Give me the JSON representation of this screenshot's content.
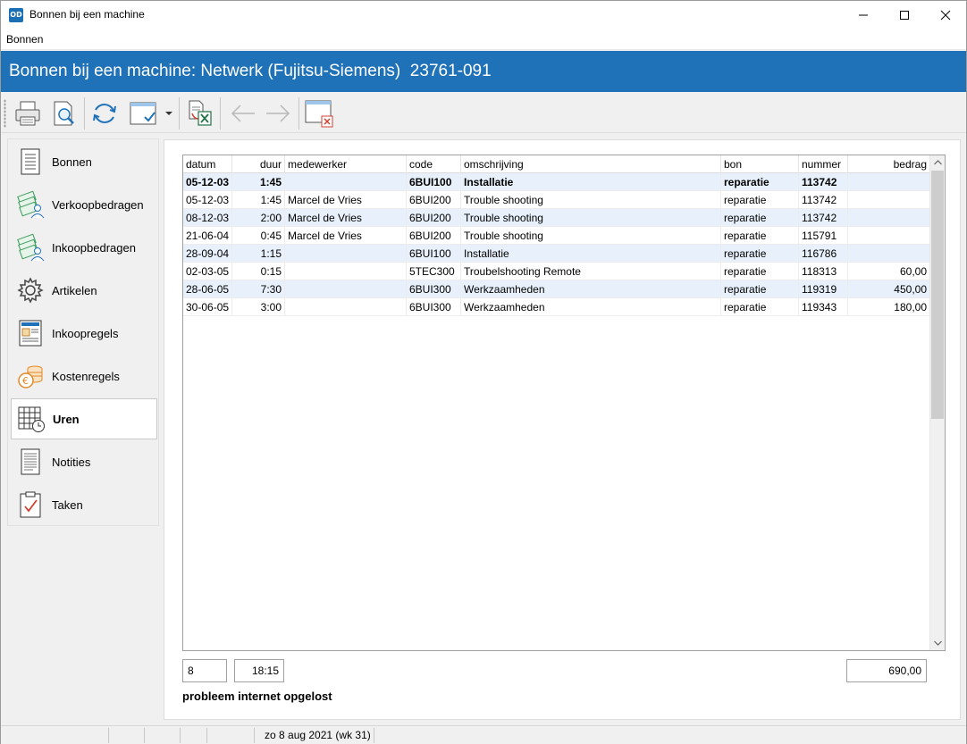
{
  "window": {
    "app_icon_text": "OD",
    "title": "Bonnen bij een machine"
  },
  "menu": {
    "items": [
      "Bonnen"
    ]
  },
  "header": {
    "title": "Bonnen bij een machine: Netwerk (Fujitsu-Siemens)  23761-091",
    "color": "#1f72b8"
  },
  "toolbar": {
    "buttons": [
      {
        "icon": "printer-icon"
      },
      {
        "icon": "print-preview-icon"
      },
      {
        "icon": "refresh-icon"
      },
      {
        "icon": "select-columns-icon"
      },
      {
        "icon": "export-excel-icon"
      },
      {
        "icon": "arrow-left-icon",
        "enabled": false
      },
      {
        "icon": "arrow-right-icon",
        "enabled": false
      },
      {
        "icon": "close-window-icon"
      }
    ]
  },
  "sidebar": {
    "items": [
      {
        "label": "Bonnen",
        "icon": "document-icon"
      },
      {
        "label": "Verkoopbedragen",
        "icon": "money-person-icon"
      },
      {
        "label": "Inkoopbedragen",
        "icon": "money-person-icon"
      },
      {
        "label": "Artikelen",
        "icon": "gear-icon"
      },
      {
        "label": "Inkoopregels",
        "icon": "invoice-icon"
      },
      {
        "label": "Kostenregels",
        "icon": "coins-euro-icon"
      },
      {
        "label": "Uren",
        "icon": "calendar-clock-icon",
        "active": true
      },
      {
        "label": "Notities",
        "icon": "notes-icon"
      },
      {
        "label": "Taken",
        "icon": "clipboard-check-icon"
      }
    ]
  },
  "table": {
    "columns": [
      "datum",
      "duur",
      "medewerker",
      "code",
      "omschrijving",
      "bon",
      "nummer",
      "bedrag"
    ],
    "rows": [
      {
        "datum": "05-12-03",
        "duur": "1:45",
        "medewerker": "",
        "code": "6BUI100",
        "omschrijving": "Installatie",
        "bon": "reparatie",
        "nummer": "113742",
        "bedrag": "",
        "bold": true
      },
      {
        "datum": "05-12-03",
        "duur": "1:45",
        "medewerker": "Marcel de Vries",
        "code": "6BUI200",
        "omschrijving": "Trouble shooting",
        "bon": "reparatie",
        "nummer": "113742",
        "bedrag": ""
      },
      {
        "datum": "08-12-03",
        "duur": "2:00",
        "medewerker": "Marcel de Vries",
        "code": "6BUI200",
        "omschrijving": "Trouble shooting",
        "bon": "reparatie",
        "nummer": "113742",
        "bedrag": ""
      },
      {
        "datum": "21-06-04",
        "duur": "0:45",
        "medewerker": "Marcel de Vries",
        "code": "6BUI200",
        "omschrijving": "Trouble shooting",
        "bon": "reparatie",
        "nummer": "115791",
        "bedrag": ""
      },
      {
        "datum": "28-09-04",
        "duur": "1:15",
        "medewerker": "",
        "code": "6BUI100",
        "omschrijving": "Installatie",
        "bon": "reparatie",
        "nummer": "116786",
        "bedrag": ""
      },
      {
        "datum": "02-03-05",
        "duur": "0:15",
        "medewerker": "",
        "code": "5TEC300",
        "omschrijving": "Troubelshooting Remote",
        "bon": "reparatie",
        "nummer": "118313",
        "bedrag": "60,00"
      },
      {
        "datum": "28-06-05",
        "duur": "7:30",
        "medewerker": "",
        "code": "6BUI300",
        "omschrijving": "Werkzaamheden",
        "bon": "reparatie",
        "nummer": "119319",
        "bedrag": "450,00"
      },
      {
        "datum": "30-06-05",
        "duur": "3:00",
        "medewerker": "",
        "code": "6BUI300",
        "omschrijving": "Werkzaamheden",
        "bon": "reparatie",
        "nummer": "119343",
        "bedrag": "180,00"
      }
    ]
  },
  "summary": {
    "count": "8",
    "total_duration": "18:15",
    "total_amount": "690,00"
  },
  "note": "probleem internet opgelost",
  "status": {
    "date_text": "zo 8 aug 2021 (wk 31)"
  }
}
